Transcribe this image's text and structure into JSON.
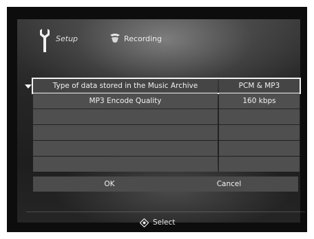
{
  "header": {
    "setup_label": "Setup",
    "recording_label": "Recording"
  },
  "settings": {
    "rows": [
      {
        "label": "Type of data stored in the Music Archive",
        "value": "PCM & MP3"
      },
      {
        "label": "MP3 Encode Quality",
        "value": "160 kbps"
      },
      {
        "label": "",
        "value": ""
      },
      {
        "label": "",
        "value": ""
      },
      {
        "label": "",
        "value": ""
      },
      {
        "label": "",
        "value": ""
      }
    ]
  },
  "buttons": {
    "ok_label": "OK",
    "cancel_label": "Cancel"
  },
  "footer": {
    "select_label": "Select"
  }
}
